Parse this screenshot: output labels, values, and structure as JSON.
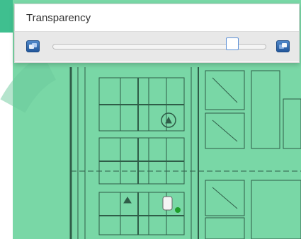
{
  "panel": {
    "title": "Transparency",
    "slider_value": 0.84,
    "left_icon": "transparency-low-icon",
    "right_icon": "transparency-high-icon"
  },
  "map": {
    "overlay_color": "#79d7a6",
    "accent_color": "#3fbf8f",
    "device_icon": "access-point-icon",
    "status_icon": "status-dot-icon",
    "status_color": "#1f9e2c"
  }
}
